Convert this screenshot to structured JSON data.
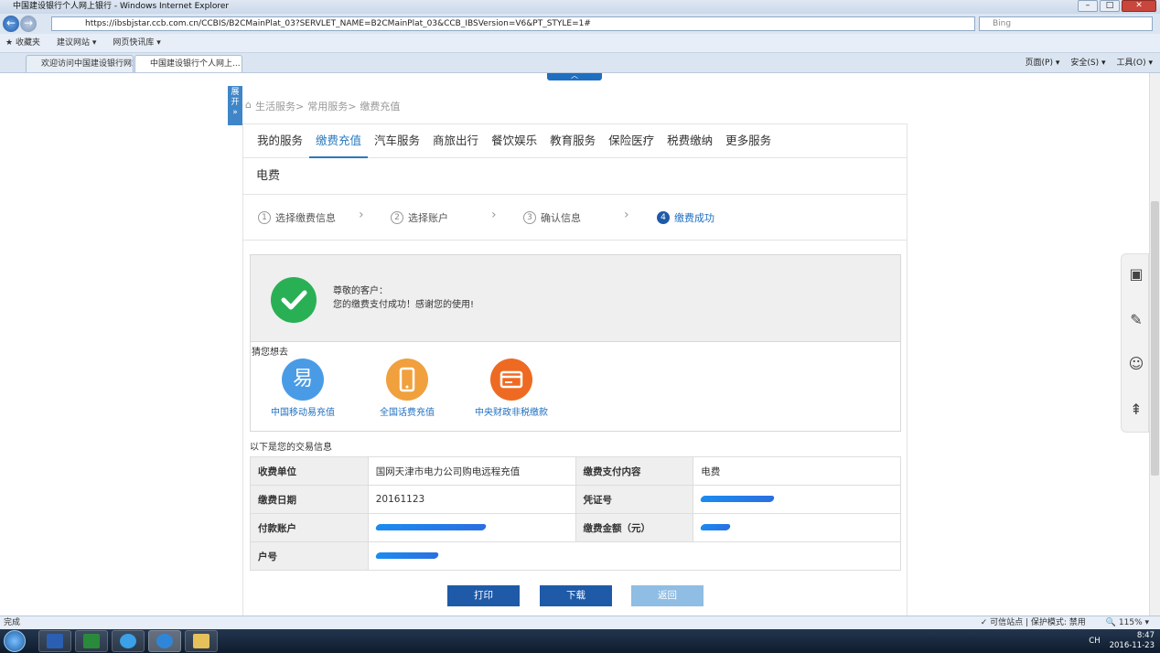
{
  "window": {
    "title": "中国建设银行个人网上银行 - Windows Internet Explorer"
  },
  "browser": {
    "url": "https://ibsbjstar.ccb.com.cn/CCBIS/B2CMainPlat_03?SERVLET_NAME=B2CMainPlat_03&CCB_IBSVersion=V6&PT_STYLE=1#",
    "search_placeholder": "Bing",
    "favorites_label": "收藏夹",
    "fav_links": [
      "建议网站 ▾",
      "网页快讯库 ▾"
    ],
    "tabs": [
      "欢迎访问中国建设银行网站",
      "中国建设银行个人网上..."
    ],
    "toolbar_items": [
      "页面(P) ▾",
      "安全(S) ▾",
      "工具(O) ▾"
    ]
  },
  "sidebar_toggle": {
    "label": "展开"
  },
  "breadcrumb": [
    "生活服务>",
    "常用服务>",
    "缴费充值"
  ],
  "nav_tabs": [
    "我的服务",
    "缴费充值",
    "汽车服务",
    "商旅出行",
    "餐饮娱乐",
    "教育服务",
    "保险医疗",
    "税费缴纳",
    "更多服务"
  ],
  "active_nav_index": 1,
  "page_title": "电费",
  "steps": [
    {
      "num": "1",
      "label": "选择缴费信息"
    },
    {
      "num": "2",
      "label": "选择账户"
    },
    {
      "num": "3",
      "label": "确认信息"
    },
    {
      "num": "4",
      "label": "缴费成功"
    }
  ],
  "success": {
    "greeting": "尊敬的客户：",
    "message": "您的缴费支付成功！感谢您的使用!"
  },
  "guess": {
    "title": "猜您想去",
    "items": [
      {
        "label": "中国移动易充值",
        "icon": "易",
        "color": "#4a9be6"
      },
      {
        "label": "全国话费充值",
        "icon": "phone-icon",
        "color": "#f0a03c"
      },
      {
        "label": "中央财政非税缴款",
        "icon": "card-icon",
        "color": "#ee6a22"
      }
    ]
  },
  "transaction": {
    "title": "以下是您的交易信息",
    "payee_label": "收费单位",
    "payee_value": "国网天津市电力公司购电远程充值",
    "content_label": "缴费支付内容",
    "content_value": "电费",
    "date_label": "缴费日期",
    "date_value": "20161123",
    "voucher_label": "凭证号",
    "account_label": "付款账户",
    "amount_label": "缴费金额（元）",
    "household_label": "户号"
  },
  "buttons": {
    "print": "打印",
    "download": "下载",
    "back": "返回"
  },
  "statusbar": {
    "left": "完成",
    "zone": "可信站点 | 保护模式: 禁用",
    "zoom": "115% ▾"
  },
  "taskbar": {
    "time": "8:47",
    "date": "2016-11-23",
    "lang": "CH"
  }
}
